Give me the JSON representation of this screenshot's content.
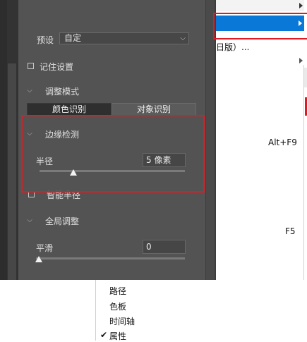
{
  "panel": {
    "preset_label": "预设",
    "preset_value": "自定",
    "remember_label": "记住设置",
    "mode_section": "调整模式",
    "mode_tabs": [
      "颜色识别",
      "对象识别"
    ],
    "edge_section": "边缘检测",
    "radius_label": "半径",
    "radius_value": "5 像素",
    "radius_slider_fraction": 0.2,
    "smart_radius_label": "智能半径",
    "global_section": "全局调整",
    "smooth_label": "平滑",
    "smooth_value": "0",
    "smooth_slider_fraction": 0.0
  },
  "menu": {
    "version_item": "日版）...",
    "shortcut_1": "Alt+F9",
    "shortcut_2": "F5",
    "bottom_items": [
      "路径",
      "色板",
      "时间轴",
      "属性"
    ],
    "checked_item": "属性",
    "check_glyph": "✔"
  },
  "colors": {
    "highlight": "#e01b24",
    "menu_selected": "#0a78d7",
    "panel_bg": "#535353"
  },
  "icons": {
    "section_chevron": "chevron-down-icon",
    "select_arrow": "chevron-down-icon",
    "submenu_arrow": "triangle-right-icon"
  }
}
